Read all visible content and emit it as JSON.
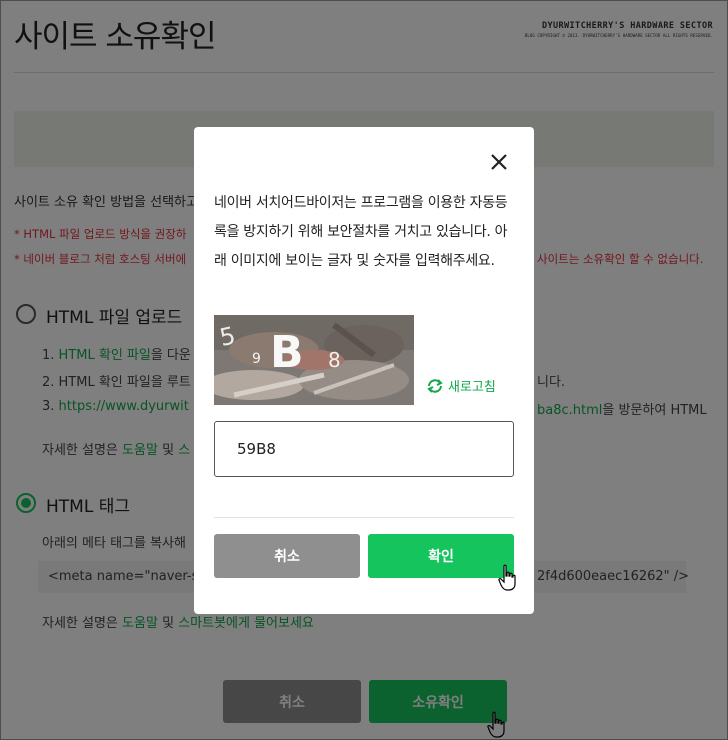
{
  "header": {
    "title": "사이트 소유확인",
    "watermark_title": "DYURWITCHERRY'S HARDWARE SECTOR",
    "watermark_sub": "BLOG COPYRIGHT © 2013. DYURWITCHERRY'S HARDWARE SECTOR ALL RIGHTS RESERVED."
  },
  "page": {
    "intro": "사이트 소유 확인 방법을 선택하고",
    "warn_1": "* HTML 파일 업로드 방식을 권장하",
    "warn_2": "* 네이버 블로그 처럼 호스팅 서버에",
    "warn_2_right": "사이트는 소유확인 할 수 없습니다.",
    "option_1": "HTML 파일 업로드",
    "step_1_prefix": "1.",
    "step_1_link": "HTML 확인 파일",
    "step_1_suffix": "을 다운",
    "step_2": "2. HTML 확인 파일을 루트",
    "step_2_right": "니다.",
    "step_3_prefix": "3.",
    "step_3_link": "https://www.dyurwit",
    "step_3_right_link": "ba8c.html",
    "step_3_right_suffix": "을 방문하여 HTML",
    "help_prefix": "자세한 설명은",
    "help_link_1": "도움말",
    "help_mid": "및",
    "help_link_2_partial": "스",
    "option_2": "HTML 태그",
    "meta_desc": "아래의 메타 태그를 복사해 ",
    "meta_left": "<meta name=\"naver-sit",
    "meta_right": "2f4d600eaec16262\" />",
    "help2_prefix": "자세한 설명은",
    "help2_link_1": "도움말",
    "help2_mid": "및",
    "help2_link_2": "스마트봇에게 물어보세요",
    "cancel_label": "취소",
    "confirm_label": "소유확인"
  },
  "modal": {
    "text": "네이버 서치어드바이저는 프로그램을 이용한 자동등록을 방지하기 위해 보안절차를 거치고 있습니다. 아래 이미지에 보이는 글자 및 숫자를 입력해주세요.",
    "refresh_label": "새로고침",
    "input_value": "59B8",
    "cancel_label": "취소",
    "ok_label": "확인",
    "captcha_chars": [
      "5",
      "9",
      "B",
      "8"
    ]
  },
  "colors": {
    "accent": "#16c45e",
    "link": "#12a84a",
    "warning": "#e0303c",
    "gray_button": "#8f8f8f"
  }
}
